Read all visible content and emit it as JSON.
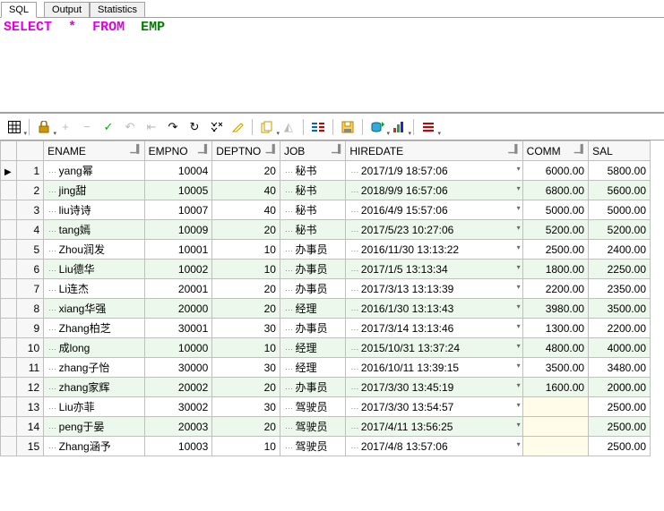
{
  "tabs": {
    "sql": "SQL",
    "output": "Output",
    "stats": "Statistics"
  },
  "editor": {
    "select": "SELECT",
    "star": "*",
    "from": "FROM",
    "table": "EMP"
  },
  "toolbar": {
    "grid": "grid",
    "lock": "lock",
    "plus": "+",
    "minus": "−",
    "check": "✓",
    "undo1": "↶",
    "undo2": "⇤",
    "redo": "↷",
    "refresh": "↻",
    "find": "🔍",
    "eraser": "✎",
    "copy": "❐",
    "tri": "◭",
    "link": "⇶",
    "save": "💾",
    "db": "🗄",
    "chart": "📊",
    "columns": "☰"
  },
  "columns": {
    "ename": "ENAME",
    "empno": "EMPNO",
    "deptno": "DEPTNO",
    "job": "JOB",
    "hiredate": "HIREDATE",
    "comm": "COMM",
    "sal": "SAL"
  },
  "rows": [
    {
      "n": "1",
      "ename": "yang幂",
      "empno": "10004",
      "deptno": "20",
      "job": "秘书",
      "hiredate": "2017/1/9 18:57:06",
      "comm": "6000.00",
      "sal": "5800.00"
    },
    {
      "n": "2",
      "ename": "jing甜",
      "empno": "10005",
      "deptno": "40",
      "job": "秘书",
      "hiredate": "2018/9/9 16:57:06",
      "comm": "6800.00",
      "sal": "5600.00"
    },
    {
      "n": "3",
      "ename": "liu诗诗",
      "empno": "10007",
      "deptno": "40",
      "job": "秘书",
      "hiredate": "2016/4/9 15:57:06",
      "comm": "5000.00",
      "sal": "5000.00"
    },
    {
      "n": "4",
      "ename": "tang嫣",
      "empno": "10009",
      "deptno": "20",
      "job": "秘书",
      "hiredate": "2017/5/23 10:27:06",
      "comm": "5200.00",
      "sal": "5200.00"
    },
    {
      "n": "5",
      "ename": "Zhou润发",
      "empno": "10001",
      "deptno": "10",
      "job": "办事员",
      "hiredate": "2016/11/30 13:13:22",
      "comm": "2500.00",
      "sal": "2400.00"
    },
    {
      "n": "6",
      "ename": "Liu德华",
      "empno": "10002",
      "deptno": "10",
      "job": "办事员",
      "hiredate": "2017/1/5 13:13:34",
      "comm": "1800.00",
      "sal": "2250.00"
    },
    {
      "n": "7",
      "ename": "Li连杰",
      "empno": "20001",
      "deptno": "20",
      "job": "办事员",
      "hiredate": "2017/3/13 13:13:39",
      "comm": "2200.00",
      "sal": "2350.00"
    },
    {
      "n": "8",
      "ename": "xiang华强",
      "empno": "20000",
      "deptno": "20",
      "job": "经理",
      "hiredate": "2016/1/30 13:13:43",
      "comm": "3980.00",
      "sal": "3500.00"
    },
    {
      "n": "9",
      "ename": "Zhang柏芝",
      "empno": "30001",
      "deptno": "30",
      "job": "办事员",
      "hiredate": "2017/3/14 13:13:46",
      "comm": "1300.00",
      "sal": "2200.00"
    },
    {
      "n": "10",
      "ename": "成long",
      "empno": "10000",
      "deptno": "10",
      "job": "经理",
      "hiredate": "2015/10/31 13:37:24",
      "comm": "4800.00",
      "sal": "4000.00"
    },
    {
      "n": "11",
      "ename": "zhang子怡",
      "empno": "30000",
      "deptno": "30",
      "job": "经理",
      "hiredate": "2016/10/11 13:39:15",
      "comm": "3500.00",
      "sal": "3480.00"
    },
    {
      "n": "12",
      "ename": "zhang家辉",
      "empno": "20002",
      "deptno": "20",
      "job": "办事员",
      "hiredate": "2017/3/30 13:45:19",
      "comm": "1600.00",
      "sal": "2000.00"
    },
    {
      "n": "13",
      "ename": "Liu亦菲",
      "empno": "30002",
      "deptno": "30",
      "job": "驾驶员",
      "hiredate": "2017/3/30 13:54:57",
      "comm": "",
      "sal": "2500.00"
    },
    {
      "n": "14",
      "ename": "peng于晏",
      "empno": "20003",
      "deptno": "20",
      "job": "驾驶员",
      "hiredate": "2017/4/11 13:56:25",
      "comm": "",
      "sal": "2500.00"
    },
    {
      "n": "15",
      "ename": "Zhang涵予",
      "empno": "10003",
      "deptno": "10",
      "job": "驾驶员",
      "hiredate": "2017/4/8 13:57:06",
      "comm": "",
      "sal": "2500.00"
    }
  ]
}
